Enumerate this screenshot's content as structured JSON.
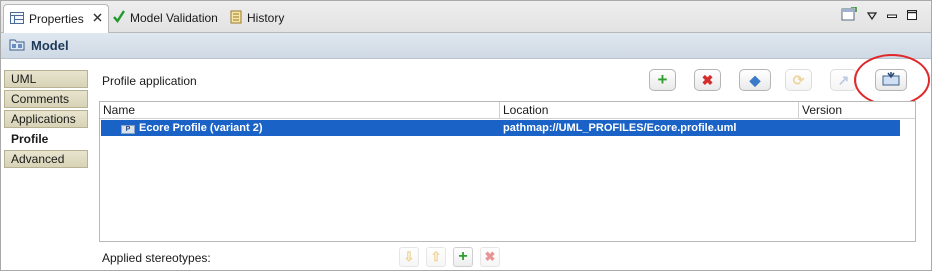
{
  "tabs": [
    {
      "label": "Properties",
      "icon": "properties-view-icon",
      "active": true
    },
    {
      "label": "Model Validation",
      "icon": "checkmark-icon",
      "active": false
    },
    {
      "label": "History",
      "icon": "history-icon",
      "active": false
    }
  ],
  "title": "Model",
  "nav": {
    "items": [
      {
        "label": "UML"
      },
      {
        "label": "Comments"
      },
      {
        "label": "Applications"
      },
      {
        "label": "Profile",
        "selected": true
      },
      {
        "label": "Advanced"
      }
    ]
  },
  "profile_section": {
    "label": "Profile application",
    "toolbar": {
      "add": "+",
      "remove": "✖",
      "apply": "◆",
      "reapply": "⟳",
      "migrate": "↗",
      "import": "⇲"
    }
  },
  "table": {
    "columns": [
      "Name",
      "Location",
      "Version"
    ],
    "rows": [
      {
        "name": "Ecore Profile (variant 2)",
        "location": "pathmap://UML_PROFILES/Ecore.profile.uml",
        "version": "",
        "icon_text": "P"
      }
    ]
  },
  "stereotypes": {
    "label": "Applied stereotypes:",
    "buttons": {
      "down": "⇩",
      "up": "⇧",
      "add": "+",
      "remove": "✖"
    }
  },
  "colors": {
    "selection": "#1a62c5",
    "add_green": "#2e9e2e",
    "remove_red": "#d42b2b",
    "highlight_ring": "#e0282b"
  }
}
